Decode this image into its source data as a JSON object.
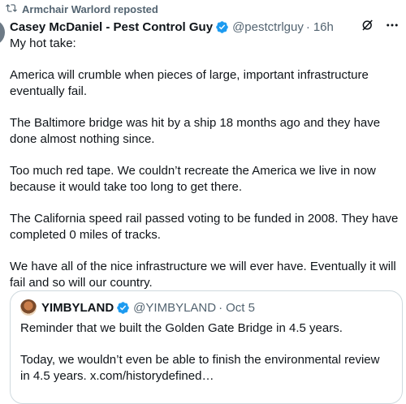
{
  "repost": {
    "label": "Armchair Warlord reposted",
    "icon": "repost-icon"
  },
  "post": {
    "author_name": "Casey McDaniel - Pest Control Guy",
    "handle": "@pestctrlguy",
    "separator": "·",
    "time": "16h",
    "paragraphs": [
      "My hot take:",
      "America will crumble when pieces of large, important infrastructure eventually fail.",
      "The Baltimore bridge was hit by a ship 18 months ago and they have done almost nothing since.",
      "Too much red tape. We couldn’t recreate the America we live in now because it would take too long to get there.",
      "The California speed rail passed voting to be funded in 2008. They have completed 0 miles of tracks.",
      "We have all of the nice infrastructure we will ever have. Eventually it will fail and so will our country."
    ]
  },
  "quote": {
    "author_name": "YIMBYLAND",
    "handle": "@YIMBYLAND",
    "separator": "·",
    "date": "Oct 5",
    "paragraphs": [
      "Reminder that we built the Golden Gate Bridge in 4.5 years.",
      "Today, we wouldn’t even be able to finish the environmental review in 4.5 years. x.com/historydefined…"
    ]
  },
  "colors": {
    "verified": "#1d9bf0",
    "muted": "#536471",
    "text": "#0f1419",
    "border": "#cfd9de"
  }
}
